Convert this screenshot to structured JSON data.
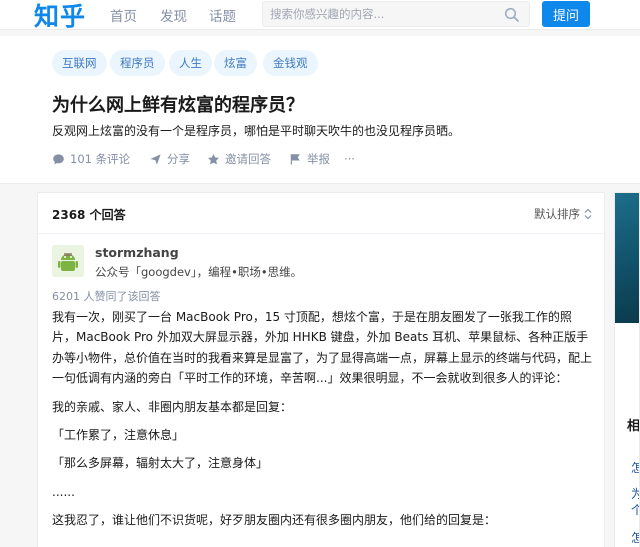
{
  "brand": "知乎",
  "nav": {
    "home": "首页",
    "explore": "发现",
    "topics": "话题"
  },
  "search": {
    "placeholder": "搜索你感兴趣的内容..."
  },
  "ask_button": "提问",
  "question": {
    "tags": [
      "互联网",
      "程序员",
      "人生",
      "炫富",
      "金钱观"
    ],
    "title": "为什么网上鲜有炫富的程序员？",
    "description": "反观网上炫富的没有一个是程序员，哪怕是平时聊天吹牛的也没见程序员晒。",
    "actions": {
      "comments": "101 条评论",
      "share": "分享",
      "invite": "邀请回答",
      "report": "举报",
      "more": "···"
    }
  },
  "answers": {
    "count": "2368 个回答",
    "sort": "默认排序",
    "first": {
      "author": "stormzhang",
      "bio": "公众号「googdev」，编程•职场•思维。",
      "votes": "6201 人赞同了该回答",
      "paragraphs": [
        "我有一次，刚买了一台 MacBook Pro，15 寸顶配，想炫个富，于是在朋友圈发了一张我工作的照片，MacBook Pro 外加双大屏显示器，外加 HHKB 键盘，外加 Beats 耳机、苹果鼠标、各种正版手办等小物件，总价值在当时的我看来算是显富了，为了显得高端一点，屏幕上显示的终端与代码，配上一句低调有内涵的旁白「平时工作的环境，辛苦啊...」效果很明显，不一会就收到很多人的评论：",
        "我的亲戚、家人、非圈内朋友基本都是回复：",
        "「工作累了，注意休息」",
        "「那么多屏幕，辐射太大了，注意身体」",
        "......",
        "这我忍了，谁让他们不识货呢，好歹朋友圈内还有很多圈内朋友，他们给的回复是："
      ]
    }
  },
  "sidebar": {
    "heading": "相",
    "links": [
      "怎",
      "为",
      "个",
      "怎"
    ]
  },
  "colors": {
    "brand": "#0f88eb",
    "tag_bg": "#ebf5fd",
    "tag_text": "#3e7ac2",
    "meta": "#8590a6"
  }
}
